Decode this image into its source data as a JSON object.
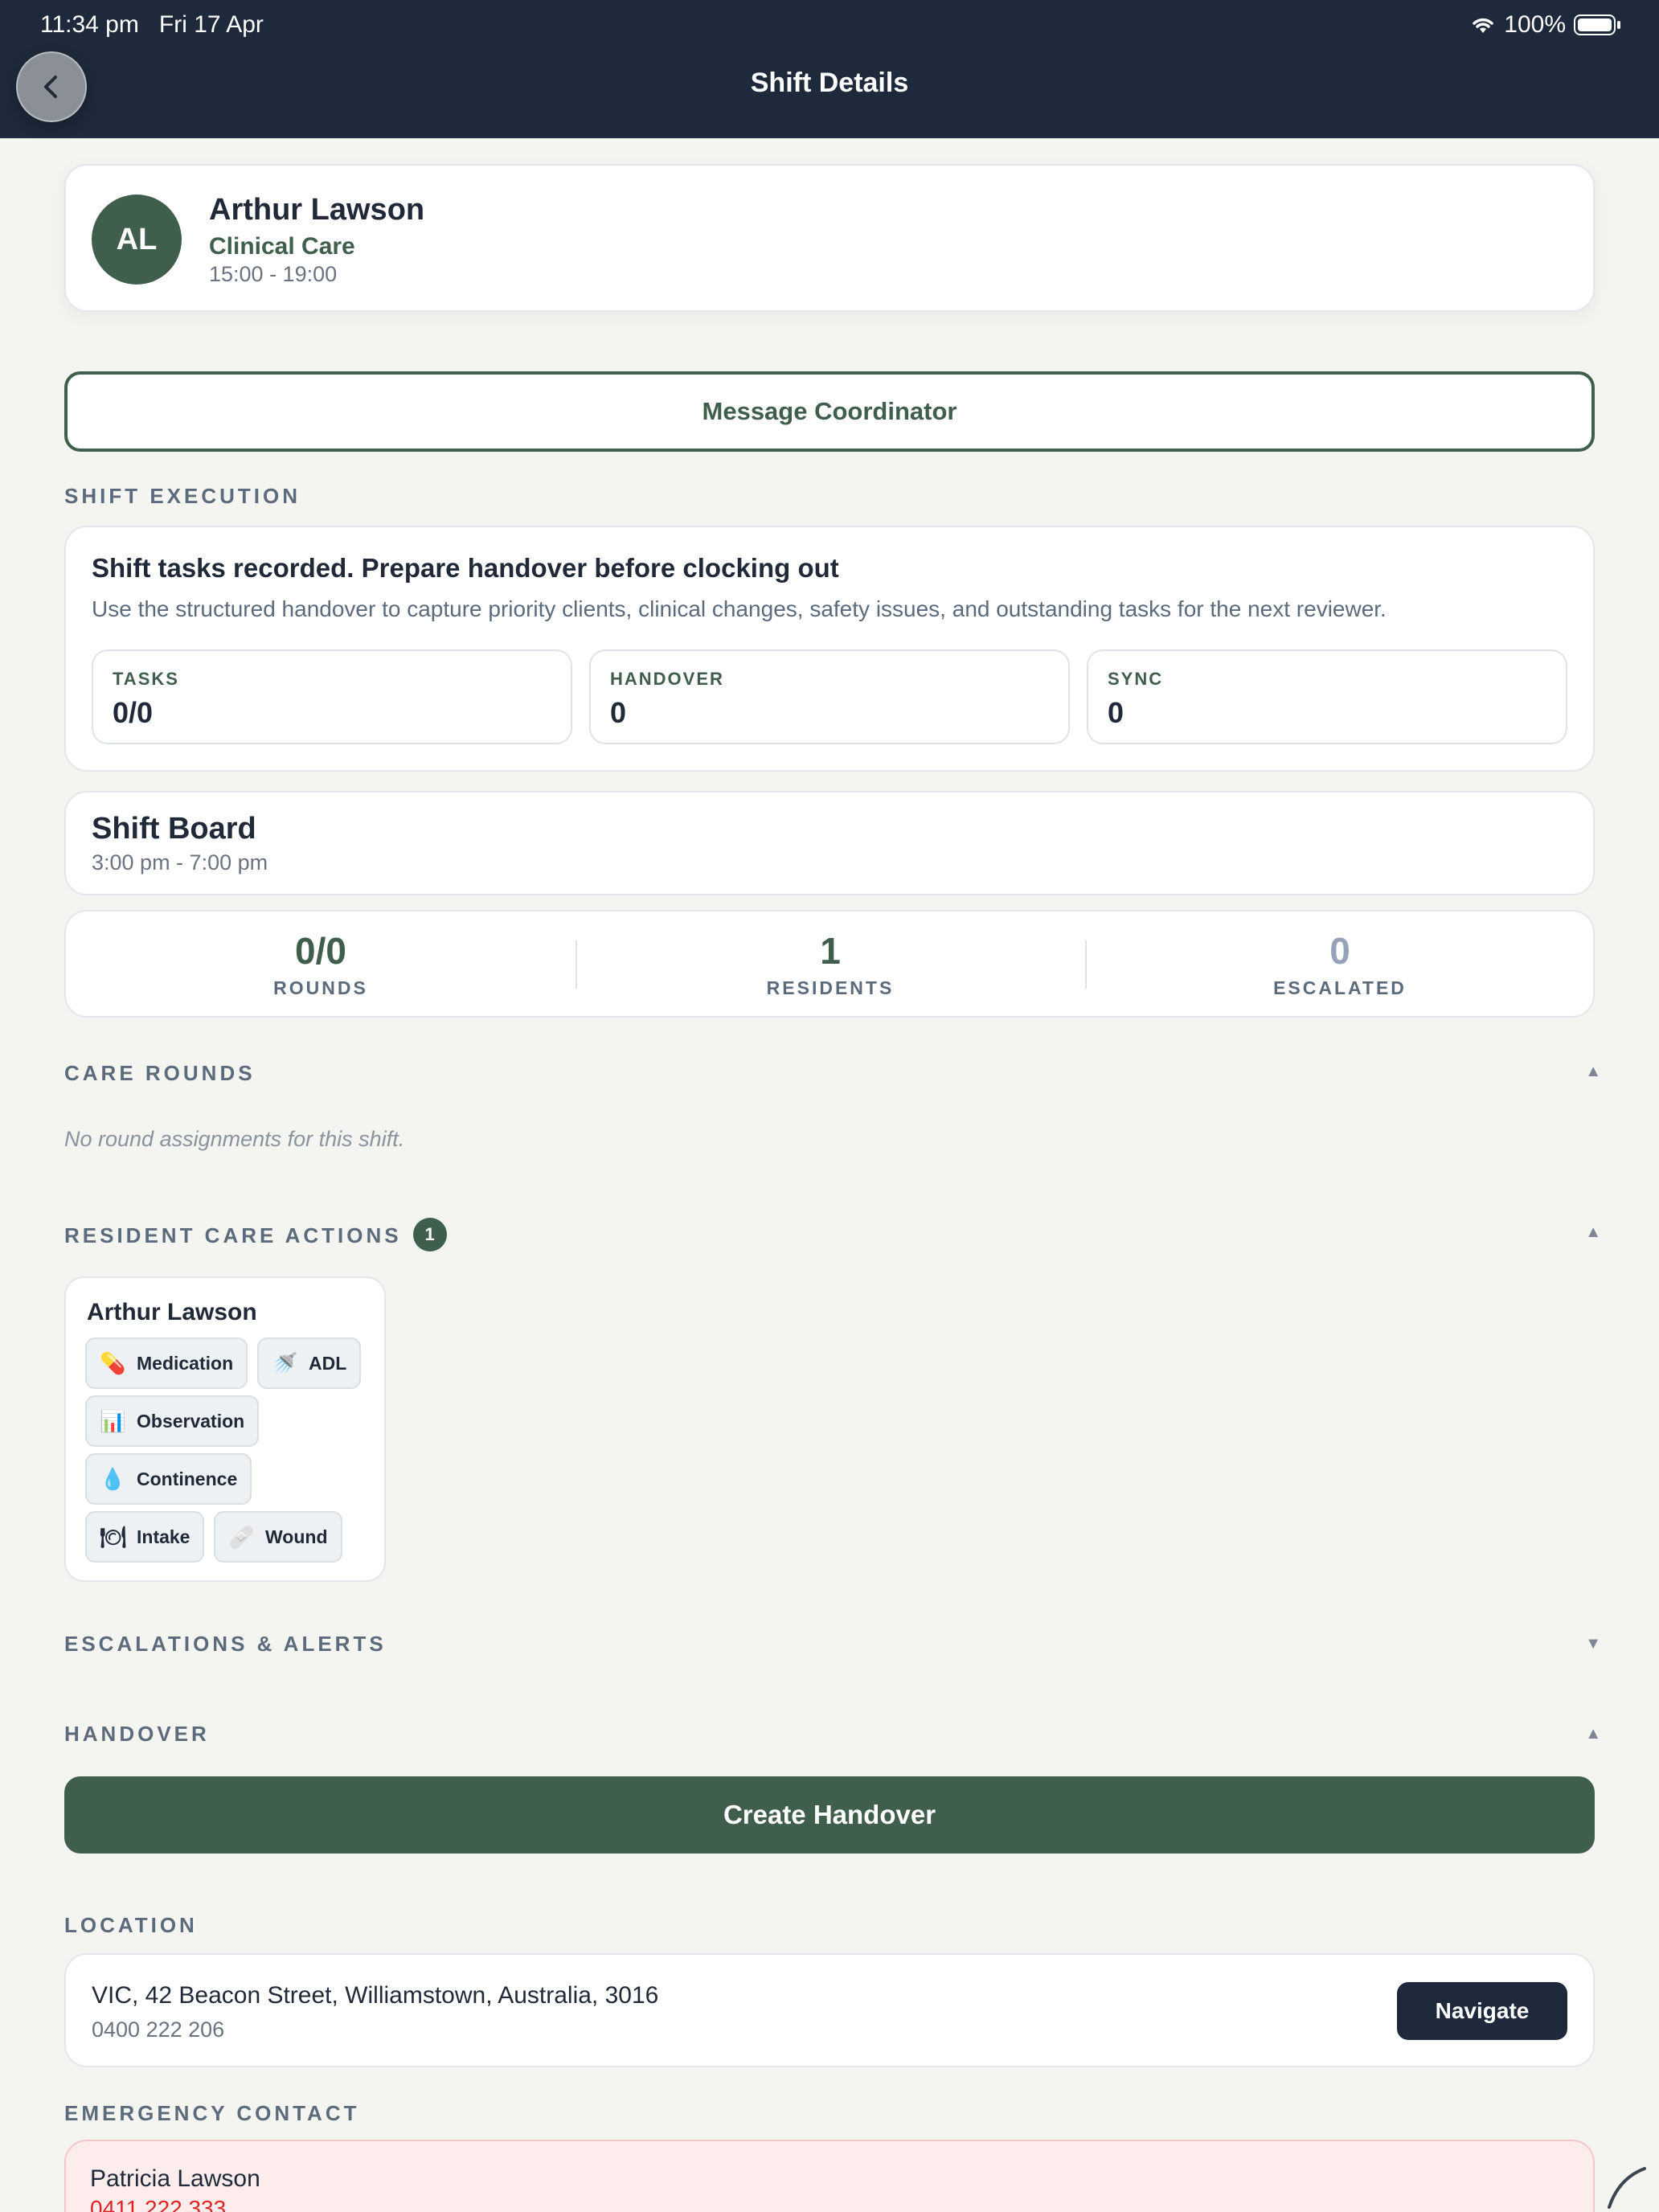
{
  "status_bar": {
    "time": "11:34 pm",
    "date": "Fri 17 Apr",
    "battery": "100%"
  },
  "header": {
    "title": "Shift Details"
  },
  "profile": {
    "initials": "AL",
    "name": "Arthur Lawson",
    "role": "Clinical Care",
    "time": "15:00 - 19:00"
  },
  "message_button": "Message Coordinator",
  "shift_execution": {
    "label": "SHIFT EXECUTION",
    "title": "Shift tasks recorded. Prepare handover before clocking out",
    "description": "Use the structured handover to capture priority clients, clinical changes, safety issues, and outstanding tasks for the next reviewer.",
    "stats": [
      {
        "label": "TASKS",
        "value": "0/0"
      },
      {
        "label": "HANDOVER",
        "value": "0"
      },
      {
        "label": "SYNC",
        "value": "0"
      }
    ]
  },
  "shift_board": {
    "title": "Shift Board",
    "time": "3:00 pm - 7:00 pm"
  },
  "metrics": [
    {
      "value": "0/0",
      "label": "ROUNDS",
      "color": "#3f5e4b"
    },
    {
      "value": "1",
      "label": "RESIDENTS",
      "color": "#3f5e4b"
    },
    {
      "value": "0",
      "label": "ESCALATED",
      "color": "#94a3b8"
    }
  ],
  "care_rounds": {
    "label": "CARE ROUNDS",
    "empty": "No round assignments for this shift."
  },
  "resident_care": {
    "label": "RESIDENT CARE ACTIONS",
    "count": "1",
    "resident_name": "Arthur Lawson",
    "actions": [
      {
        "label": "Medication",
        "icon": "pill-icon",
        "glyph": "💊"
      },
      {
        "label": "ADL",
        "icon": "shower-icon",
        "glyph": "🚿"
      },
      {
        "label": "Observation",
        "icon": "chart-icon",
        "glyph": "📊"
      },
      {
        "label": "Continence",
        "icon": "droplet-icon",
        "glyph": "💧"
      },
      {
        "label": "Intake",
        "icon": "plate-icon",
        "glyph": "🍽"
      },
      {
        "label": "Wound",
        "icon": "bandage-icon",
        "glyph": "🩹"
      }
    ]
  },
  "escalations": {
    "label": "ESCALATIONS & ALERTS"
  },
  "handover": {
    "label": "HANDOVER",
    "button": "Create Handover"
  },
  "location": {
    "label": "LOCATION",
    "address": "VIC, 42 Beacon Street, Williamstown, Australia, 3016",
    "phone": "0400 222 206",
    "button": "Navigate"
  },
  "emergency": {
    "label": "EMERGENCY CONTACT",
    "name": "Patricia Lawson",
    "phone": "0411 222 333"
  }
}
